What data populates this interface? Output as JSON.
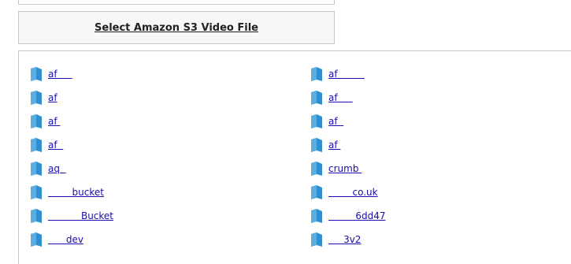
{
  "header": {
    "title": "Select Amazon S3 Video File"
  },
  "buckets": {
    "left": [
      {
        "label": "af     "
      },
      {
        "label": "af"
      },
      {
        "label": "af "
      },
      {
        "label": "af  "
      },
      {
        "label": "aq  "
      },
      {
        "label": "        bucket"
      },
      {
        "label": "           Bucket"
      },
      {
        "label": "      dev"
      }
    ],
    "right": [
      {
        "label": "af         "
      },
      {
        "label": "af     "
      },
      {
        "label": "af  "
      },
      {
        "label": "af "
      },
      {
        "label": "crumb "
      },
      {
        "label": "        co.uk"
      },
      {
        "label": "         6dd47"
      },
      {
        "label": "     3v2"
      }
    ]
  },
  "icons": {
    "folder": "folder-icon"
  },
  "colors": {
    "link": "#1a0dab",
    "folder": "#2f8fcf"
  }
}
